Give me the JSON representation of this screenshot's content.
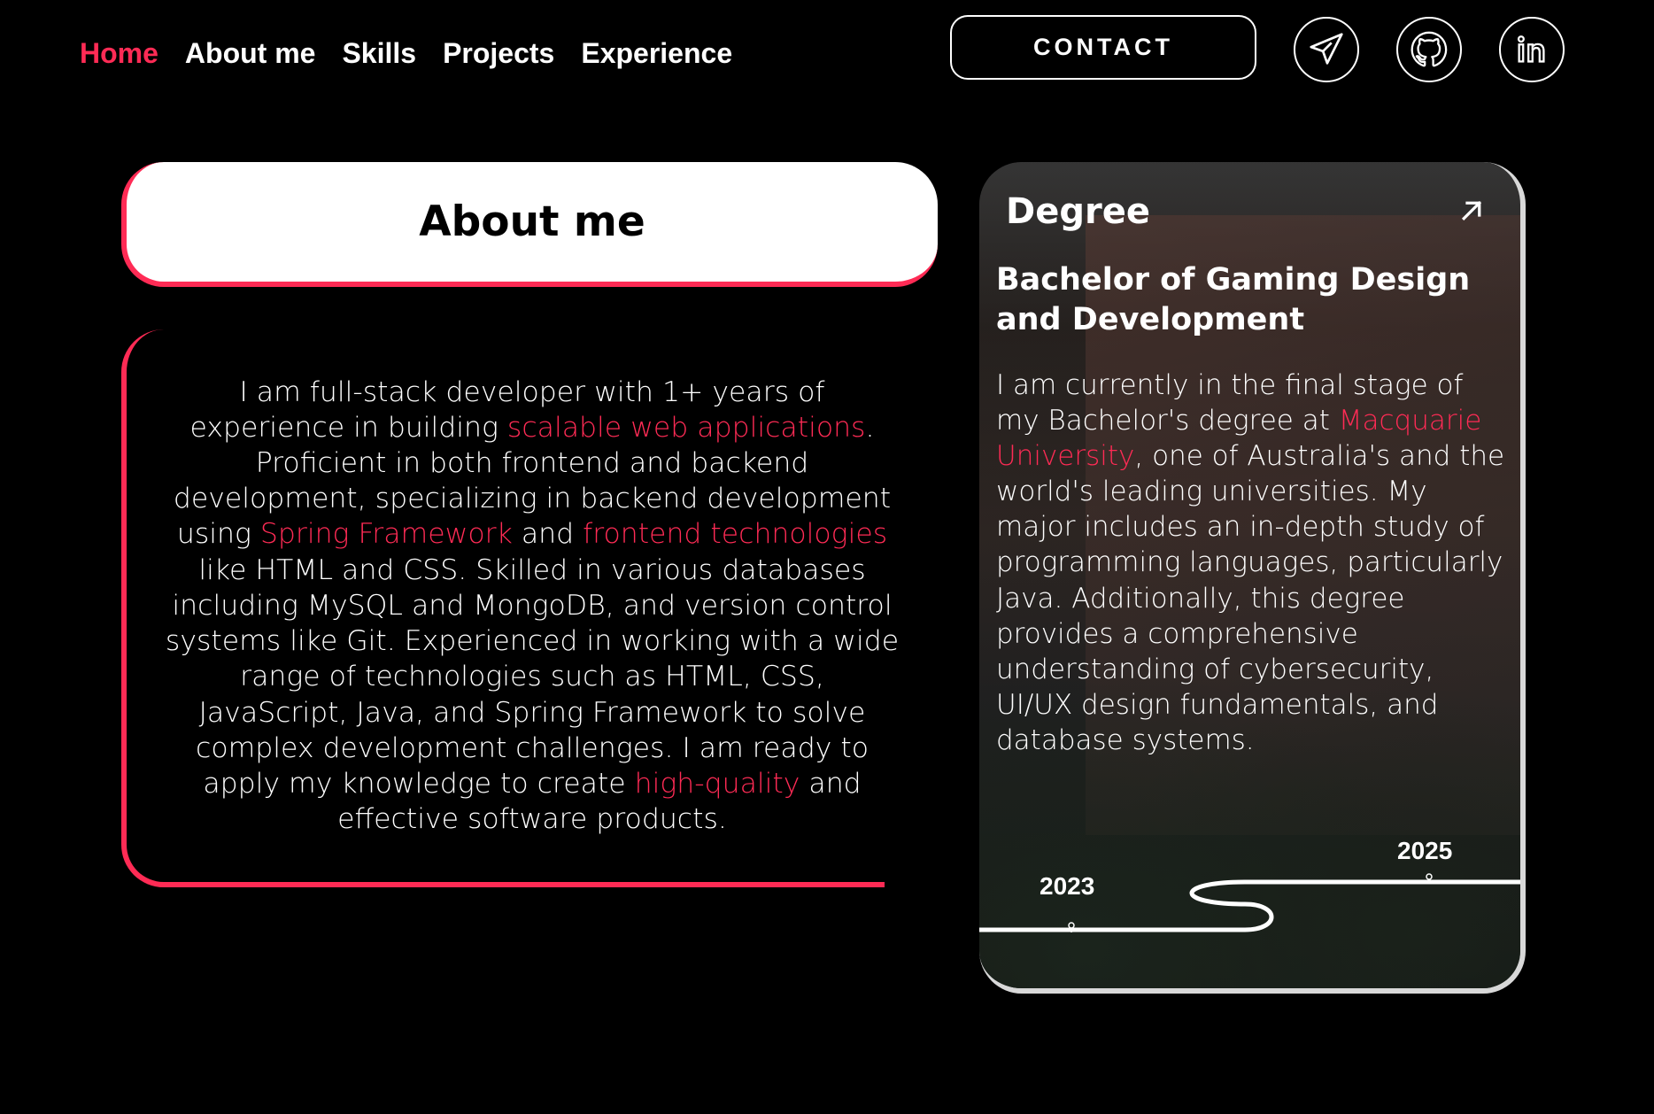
{
  "nav": {
    "items": [
      "Home",
      "About me",
      "Skills",
      "Projects",
      "Experience"
    ],
    "active": "Home"
  },
  "header": {
    "contact_label": "CONTACT",
    "social": [
      "telegram-icon",
      "github-icon",
      "linkedin-icon"
    ]
  },
  "about": {
    "title": "About me",
    "p1": "I am full-stack developer with 1+ years of experience in building ",
    "hl1": "scalable web applications",
    "p2": ". Proficient in both frontend and backend development, specializing in backend development using ",
    "hl2": "Spring Framework",
    "p3": " and ",
    "hl3": "frontend technologies",
    "p4": " like HTML and CSS. Skilled in various databases including MySQL and MongoDB, and version control systems like Git. Experienced in working with a wide range of technologies such as HTML, CSS, JavaScript, Java, and Spring Framework to solve complex development challenges. I am ready to apply my knowledge to create ",
    "hl4": "high-quality",
    "p5": " and effective software products."
  },
  "degree": {
    "heading": "Degree",
    "name": "Bachelor of Gaming Design and Development",
    "d1": "I am currently in the final stage of my Bachelor's degree at ",
    "hl": "Macquarie University",
    "d2": ", one of Australia's and the world's leading universities. My major includes an in-depth study of programming languages, particularly Java. Additionally, this degree provides a comprehensive understanding of cybersecurity, UI/UX design fundamentals, and database systems.",
    "start_year": "2023",
    "end_year": "2025"
  },
  "colors": {
    "accent": "#ff2b55",
    "background": "#000000"
  }
}
